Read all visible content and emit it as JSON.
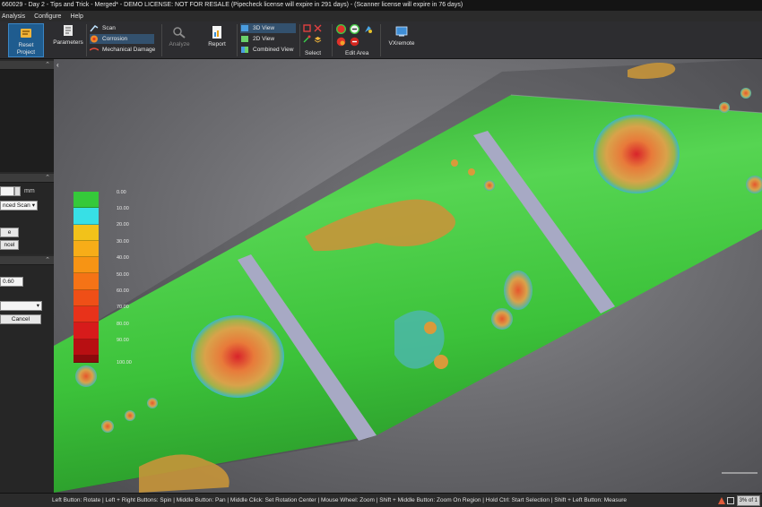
{
  "window": {
    "title": "660029 - Day 2 - Tips and Trick - Merged* - DEMO LICENSE: NOT FOR RESALE (Pipecheck license will expire in 291 days) - (Scanner license will expire in 76 days)"
  },
  "menu": [
    "Analysis",
    "Configure",
    "Help"
  ],
  "ribbon": {
    "reset_label": "Reset\nProject",
    "parameters_label": "Parameters",
    "modes": [
      "Scan",
      "Corrosion",
      "Mechanical Damage"
    ],
    "analyze_label": "Analyze",
    "report_label": "Report",
    "views": [
      "3D View",
      "2D View",
      "Combined View"
    ],
    "select_label": "Select",
    "edit_area_label": "Edit Area",
    "vxremote_label": "VXremote"
  },
  "left_panel": {
    "unit_label": "mm",
    "scan_dropdown": "nced Scan",
    "button_e": "e",
    "button_cancel_partial": "ncel",
    "threshold_value": "0.60",
    "cancel_label": "Cancel"
  },
  "legend": {
    "ticks": [
      "0.00",
      "10.00",
      "20.00",
      "30.00",
      "40.00",
      "50.00",
      "60.00",
      "70.00",
      "80.00",
      "90.00",
      "100.00"
    ],
    "colors": [
      "#35c93a",
      "#37e0e6",
      "#f2c21a",
      "#f7ad18",
      "#f79414",
      "#f57316",
      "#ef4f17",
      "#e8321a",
      "#d71b1b",
      "#b80f12",
      "#8c0a0d"
    ]
  },
  "status": {
    "help_text": "Left Button: Rotate | Left + Right Buttons: Spin | Middle Button: Pan | Middle Click: Set Rotation Center | Mouse Wheel: Zoom | Shift + Middle Button: Zoom On Region | Hold Ctrl: Start Selection | Shift + Left Button: Measure",
    "zoom_text": "3% of 1"
  },
  "colors": {
    "pipe_green": "#3cc23a",
    "ribbon_bg": "#2d2d30",
    "selected_mode": "#33516e"
  }
}
